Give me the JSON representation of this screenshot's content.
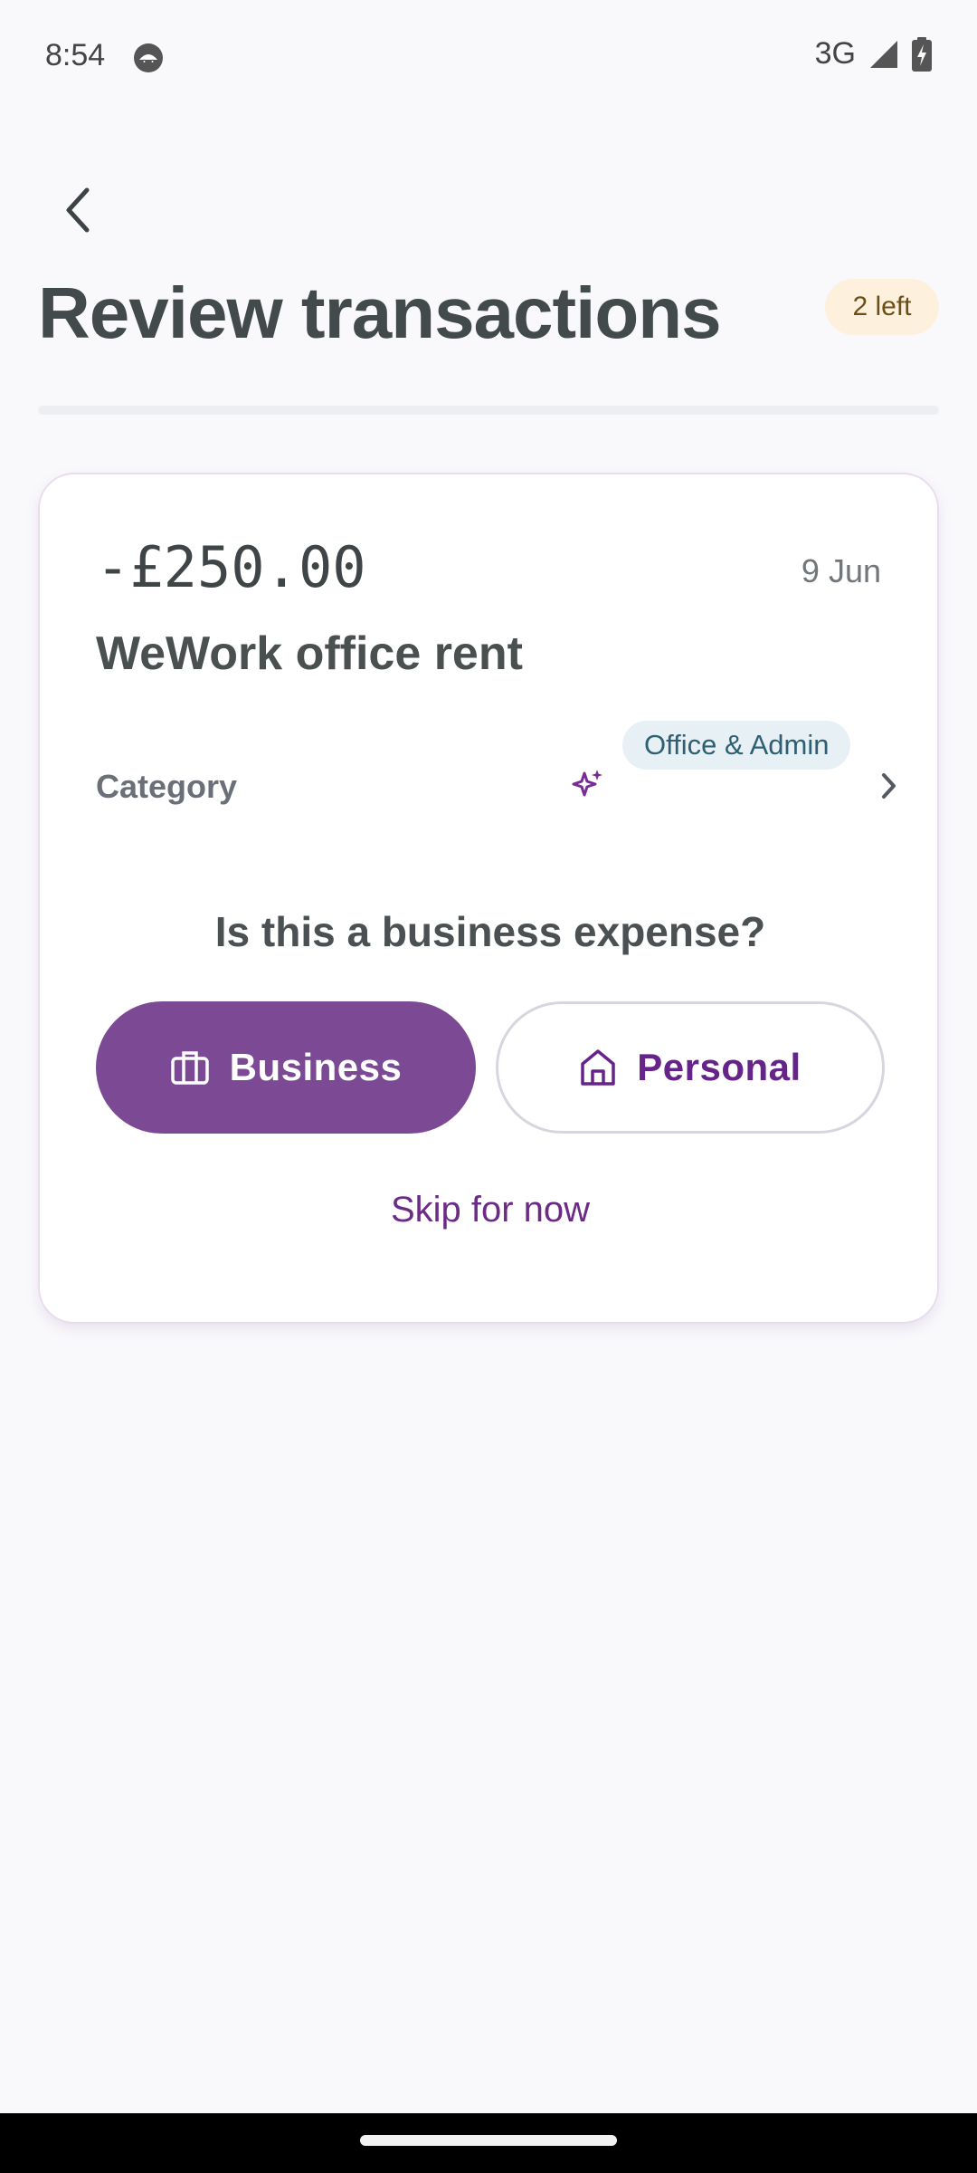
{
  "status_bar": {
    "time": "8:54",
    "network": "3G",
    "app_icon": "android-face-icon",
    "signal_icon": "cell-signal-icon",
    "battery_icon": "battery-charging-icon"
  },
  "header": {
    "back_icon": "chevron-left-icon",
    "title": "Review transactions",
    "remaining_badge": "2 left",
    "progress_fraction": 0
  },
  "transaction": {
    "amount": "-£250.00",
    "date": "9 Jun",
    "merchant": "WeWork office rent",
    "category_label": "Category",
    "category_value": "Office & Admin",
    "category_ai_icon": "sparkle-icon",
    "category_chevron_icon": "chevron-right-icon"
  },
  "expense_prompt": {
    "question": "Is this a business expense?",
    "business_label": "Business",
    "business_icon": "briefcase-icon",
    "personal_label": "Personal",
    "personal_icon": "home-icon",
    "skip_label": "Skip for now"
  },
  "colors": {
    "primary": "#7c4a94",
    "primary_text": "#66238a",
    "badge_bg": "#fdf1de",
    "chip_bg": "#e7f1f5",
    "background": "#f9f9fc"
  }
}
